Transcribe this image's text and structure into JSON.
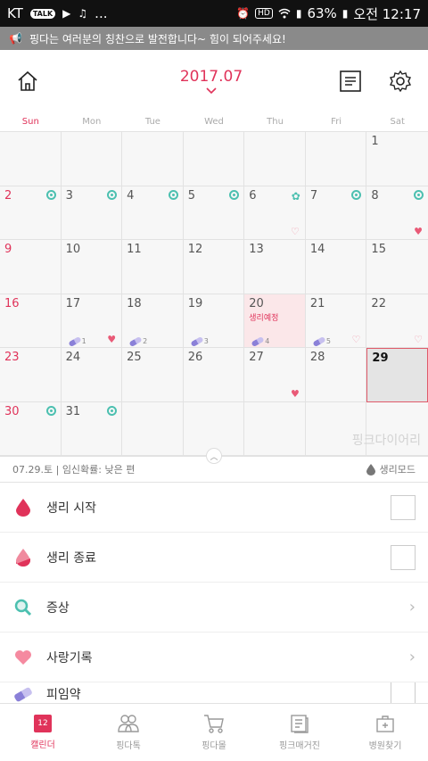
{
  "status": {
    "carrier": "KT",
    "battery": "63%",
    "time": "오전 12:17",
    "more": "..."
  },
  "notice": "핑다는 여러분의 칭찬으로 발전합니다~ 힘이 되어주세요!",
  "header": {
    "month": "2017.07"
  },
  "weekdays": [
    "Sun",
    "Mon",
    "Tue",
    "Wed",
    "Thu",
    "Fri",
    "Sat"
  ],
  "days": {
    "d1": "1",
    "d2": "2",
    "d3": "3",
    "d4": "4",
    "d5": "5",
    "d6": "6",
    "d7": "7",
    "d8": "8",
    "d9": "9",
    "d10": "10",
    "d11": "11",
    "d12": "12",
    "d13": "13",
    "d14": "14",
    "d15": "15",
    "d16": "16",
    "d17": "17",
    "d18": "18",
    "d19": "19",
    "d20": "20",
    "d21": "21",
    "d22": "22",
    "d23": "23",
    "d24": "24",
    "d25": "25",
    "d26": "26",
    "d27": "27",
    "d28": "28",
    "d29": "29",
    "d30": "30",
    "d31": "31"
  },
  "day20_note": "생리예정",
  "pill_counts": {
    "p17": "1",
    "p18": "2",
    "p19": "3",
    "p20": "4",
    "p21": "5"
  },
  "watermark": "핑크다이어리",
  "info": {
    "date": "07.29.토",
    "status": "임신확률: 낮은 편",
    "mode": "생리모드"
  },
  "list": {
    "period_start": "생리 시작",
    "period_end": "생리 종료",
    "symptom": "증상",
    "love": "사랑기록",
    "pill": "피임약"
  },
  "tabs": {
    "calendar": "캘린더",
    "calendar_badge": "12",
    "talk": "핑다톡",
    "mall": "핑다몰",
    "magazine": "핑크매거진",
    "hospital": "병원찾기"
  },
  "colors": {
    "accent": "#e0335a",
    "mint": "#4cc0b0"
  }
}
